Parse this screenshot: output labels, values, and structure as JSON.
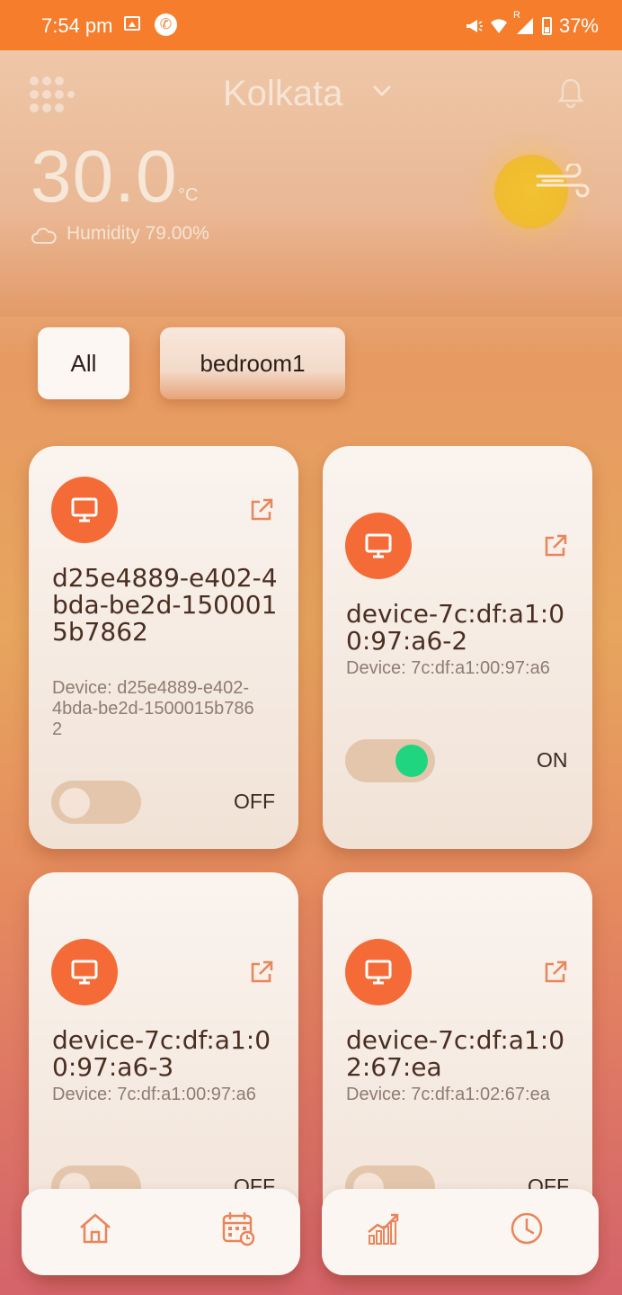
{
  "status_bar": {
    "time": "7:54 pm",
    "battery": "37%",
    "roaming_marker": "R"
  },
  "header": {
    "city": "Kolkata",
    "temperature": "30.0",
    "unit": "°C",
    "humidity": "Humidity 79.00%"
  },
  "filters": [
    {
      "label": "All"
    },
    {
      "label": "bedroom1"
    }
  ],
  "devices": [
    {
      "name": "d25e4889-e402-4bda-be2d-1500015b7862",
      "subtitle": "Device: d25e4889-e402-4bda-be2d-1500015b7862",
      "state": "OFF",
      "on": false
    },
    {
      "name": "device-7c:df:a1:00:97:a6-2",
      "subtitle": "Device: 7c:df:a1:00:97:a6",
      "state": "ON",
      "on": true
    },
    {
      "name": "device-7c:df:a1:00:97:a6-3",
      "subtitle": "Device: 7c:df:a1:00:97:a6",
      "state": "OFF",
      "on": false
    },
    {
      "name": "device-7c:df:a1:02:67:ea",
      "subtitle": "Device: 7c:df:a1:02:67:ea",
      "state": "OFF",
      "on": false
    }
  ],
  "bottom_nav": {
    "icons": [
      "home-icon",
      "calendar-icon",
      "chart-icon",
      "clock-icon"
    ]
  },
  "colors": {
    "status_bar": "#f57d2c",
    "accent": "#f46b37",
    "toggle_on": "#1fd57f",
    "icon_stroke": "#e8855a"
  }
}
